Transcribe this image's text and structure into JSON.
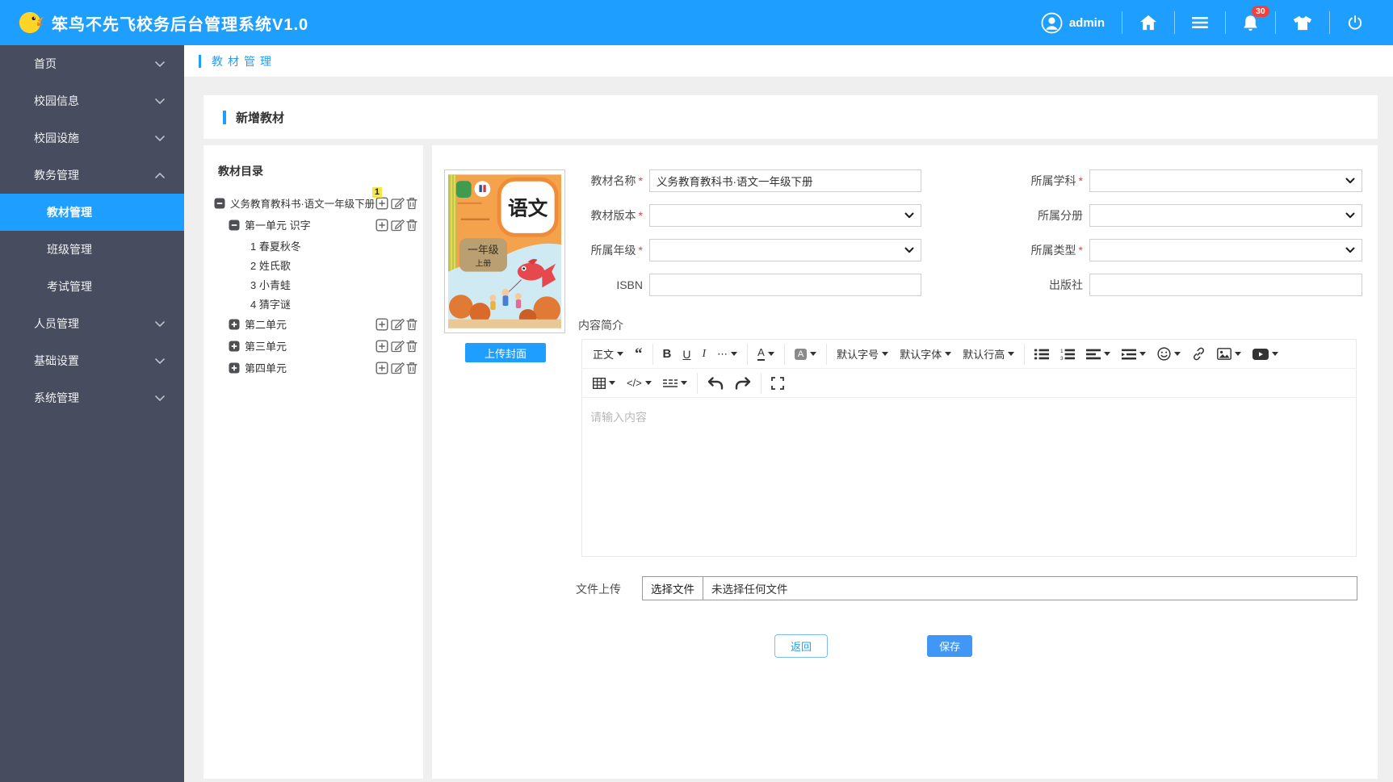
{
  "header": {
    "title": "笨鸟不先飞校务后台管理系统V1.0",
    "user": "admin",
    "badge": "30",
    "colors": {
      "bar": "#1e9fff",
      "sidebar": "#474c5e",
      "badge": "#f3413c"
    }
  },
  "sidebar": {
    "items": [
      {
        "label": "首页"
      },
      {
        "label": "校园信息"
      },
      {
        "label": "校园设施"
      },
      {
        "label": "教务管理"
      },
      {
        "label": "人员管理"
      },
      {
        "label": "基础设置"
      },
      {
        "label": "系统管理"
      }
    ],
    "submenu": [
      "教材管理",
      "班级管理",
      "考试管理"
    ],
    "active": "教材管理"
  },
  "breadcrumb": {
    "label": "教材管理"
  },
  "page": {
    "title": "新增教材"
  },
  "catalog": {
    "title": "教材目录",
    "badge": "1",
    "root_label": "义务教育教科书·语文一年级下册",
    "unit1_label": "第一单元 识字",
    "lessons": [
      "1 春夏秋冬",
      "2 姓氏歌",
      "3 小青蛙",
      "4 猜字谜"
    ],
    "unit2_label": "第二单元",
    "unit3_label": "第三单元",
    "unit4_label": "第四单元"
  },
  "cover": {
    "subject": "语文",
    "grade": "一年级",
    "volume": "上册",
    "upload_label": "上传封面"
  },
  "form": {
    "required_mark": "*",
    "name": {
      "label": "教材名称",
      "value": "义务教育教科书·语文一年级下册"
    },
    "subject": {
      "label": "所属学科"
    },
    "version": {
      "label": "教材版本"
    },
    "fascicle": {
      "label": "所属分册"
    },
    "grade": {
      "label": "所属年级"
    },
    "type": {
      "label": "所属类型"
    },
    "isbn": {
      "label": "ISBN"
    },
    "publisher": {
      "label": "出版社"
    },
    "intro_label": "内容简介",
    "editor": {
      "paragraph": "正文",
      "quote": "“",
      "bold": "B",
      "underline": "U",
      "italic": "I",
      "more": "⋯",
      "color": "A",
      "bgcolor": "A",
      "font_size": "默认字号",
      "font_family": "默认字体",
      "line_height": "默认行高",
      "code": "</>",
      "placeholder": "请输入内容"
    },
    "upload": {
      "label": "文件上传",
      "choose": "选择文件",
      "none": "未选择任何文件"
    },
    "back": "返回",
    "save": "保存"
  }
}
